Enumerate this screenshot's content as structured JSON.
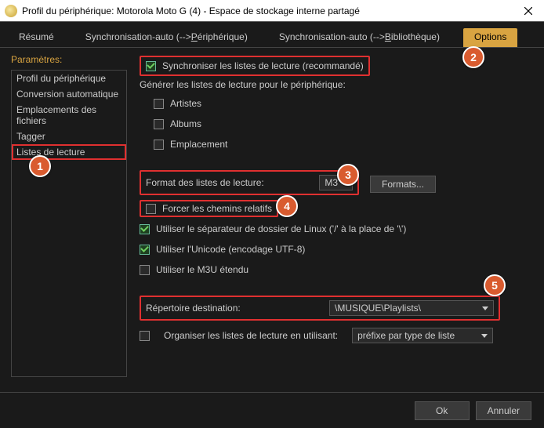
{
  "title": "Profil du périphérique: Motorola Moto G (4) - Espace de stockage interne partagé",
  "tabs": {
    "resume": "Résumé",
    "sync_device_pre": "Synchronisation-auto (-->",
    "sync_device_u": "P",
    "sync_device_post": "ériphérique)",
    "sync_lib_pre": "Synchronisation-auto (-->",
    "sync_lib_u": "B",
    "sync_lib_post": "ibliothèque)",
    "options": "Options"
  },
  "sidebar": {
    "heading": "Paramètres:",
    "items": [
      "Profil du périphérique",
      "Conversion automatique",
      "Emplacements des fichiers",
      "Tagger",
      "Listes de lecture"
    ]
  },
  "main": {
    "sync_label": "Synchroniser les listes de lecture (recommandé)",
    "generate_label": "Générer les listes de lecture pour le périphérique:",
    "artists": "Artistes",
    "albums": "Albums",
    "location": "Emplacement",
    "format_label": "Format des listes de lecture:",
    "format_value": "M3",
    "formats_btn": "Formats...",
    "force_relative": "Forcer les chemins relatifs",
    "linux_sep": "Utiliser le séparateur de dossier de Linux ('/' à la place de '\\')",
    "unicode": "Utiliser l'Unicode (encodage UTF-8)",
    "extended_m3u": "Utiliser le M3U étendu",
    "dest_label": "Répertoire destination:",
    "dest_value": "\\MUSIQUE\\Playlists\\",
    "organize_label": "Organiser les listes de lecture en utilisant:",
    "organize_value": "préfixe par type de liste"
  },
  "badges": {
    "b1": "1",
    "b2": "2",
    "b3": "3",
    "b4": "4",
    "b5": "5"
  },
  "footer": {
    "ok": "Ok",
    "cancel": "Annuler"
  }
}
